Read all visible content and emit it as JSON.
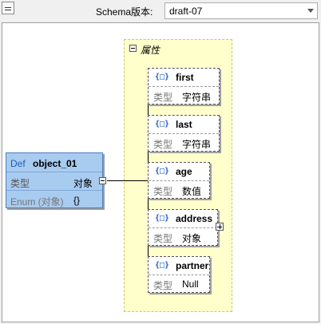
{
  "toolbar": {
    "schema_label": "Schema版本:",
    "schema_value": "draft-07"
  },
  "properties_group": {
    "title": "属性"
  },
  "definition": {
    "keyword": "Def",
    "name": "object_01",
    "type_label": "类型",
    "type_value": "对象",
    "enum_label": "Enum (对象)",
    "enum_value": "{}"
  },
  "properties": [
    {
      "name": "first",
      "type_label": "类型",
      "type_value": "字符串",
      "expandable": false
    },
    {
      "name": "last",
      "type_label": "类型",
      "type_value": "字符串",
      "expandable": false
    },
    {
      "name": "age",
      "type_label": "类型",
      "type_value": "数值",
      "expandable": false
    },
    {
      "name": "address",
      "type_label": "类型",
      "type_value": "对象",
      "expandable": true
    },
    {
      "name": "partner",
      "type_label": "类型",
      "type_value": "Null",
      "expandable": false
    }
  ],
  "icons": {
    "object": "{□}"
  }
}
